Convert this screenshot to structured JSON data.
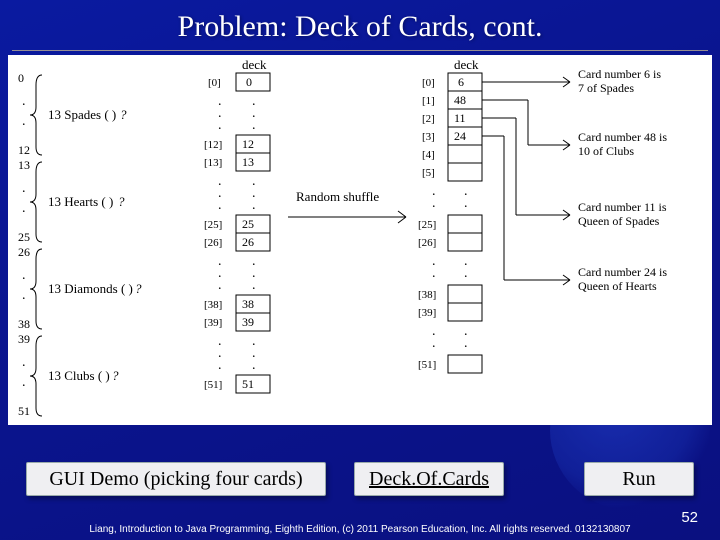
{
  "title": "Problem: Deck of Cards, cont.",
  "diagram": {
    "columns": {
      "suits": {
        "header": "deck",
        "groups": [
          {
            "start": "0",
            "end": "12",
            "label": "13 Spades (    )",
            "q": "?"
          },
          {
            "start": "13",
            "end": "25",
            "label": "13 Hearts (    )",
            "q": "?"
          },
          {
            "start": "26",
            "end": "38",
            "label": "13 Diamonds (   )",
            "q": "?"
          },
          {
            "start": "39",
            "end": "51",
            "label": "13 Clubs (    )",
            "q": "?"
          }
        ]
      },
      "ordered": {
        "header": "deck",
        "cells": [
          {
            "idx": "[0]",
            "val": "0"
          },
          {
            "idx": "",
            "val": ""
          },
          {
            "idx": "[12]",
            "val": "12"
          },
          {
            "idx": "[13]",
            "val": "13"
          },
          {
            "idx": "",
            "val": ""
          },
          {
            "idx": "[25]",
            "val": "25"
          },
          {
            "idx": "[26]",
            "val": "26"
          },
          {
            "idx": "",
            "val": ""
          },
          {
            "idx": "[38]",
            "val": "38"
          },
          {
            "idx": "[39]",
            "val": "39"
          },
          {
            "idx": "",
            "val": ""
          },
          {
            "idx": "[51]",
            "val": "51"
          }
        ]
      },
      "shuffled": {
        "header": "deck",
        "cells": [
          {
            "idx": "[0]",
            "val": "6"
          },
          {
            "idx": "[1]",
            "val": "48"
          },
          {
            "idx": "[2]",
            "val": "11"
          },
          {
            "idx": "[3]",
            "val": "24"
          },
          {
            "idx": "[4]",
            "val": ""
          },
          {
            "idx": "[5]",
            "val": ""
          },
          {
            "idx": "",
            "val": ""
          },
          {
            "idx": "[25]",
            "val": ""
          },
          {
            "idx": "[26]",
            "val": ""
          },
          {
            "idx": "",
            "val": ""
          },
          {
            "idx": "[38]",
            "val": ""
          },
          {
            "idx": "[39]",
            "val": ""
          },
          {
            "idx": "",
            "val": ""
          },
          {
            "idx": "[51]",
            "val": ""
          }
        ]
      }
    },
    "arrow_label": "Random shuffle",
    "results": [
      "Card number 6 is 7 of Spades",
      "Card number 48 is 10 of Clubs",
      "Card number 11 is Queen of Spades",
      "Card number 24 is Queen of Hearts"
    ]
  },
  "buttons": {
    "demo": "GUI Demo (picking four cards)",
    "deck": "Deck.Of.Cards",
    "run": "Run"
  },
  "footer": "Liang, Introduction to Java Programming, Eighth Edition, (c) 2011 Pearson Education, Inc. All rights reserved. 0132130807",
  "page_number": "52"
}
